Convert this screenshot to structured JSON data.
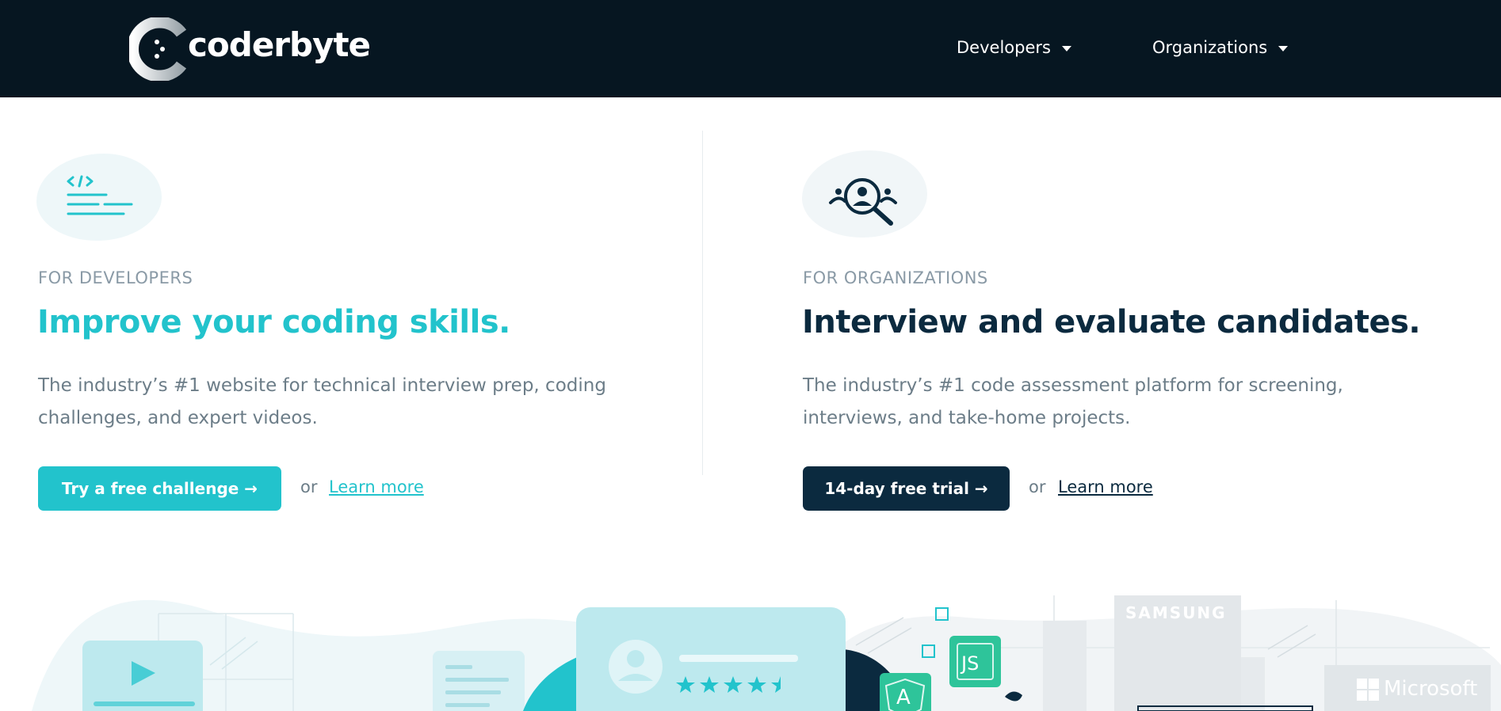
{
  "nav": {
    "logo_text": "coderbyte",
    "items": [
      {
        "label": "Developers"
      },
      {
        "label": "Organizations"
      }
    ]
  },
  "developers": {
    "eyebrow": "FOR DEVELOPERS",
    "headline": "Improve your coding skills.",
    "description_line1": "The industry’s #1 website for technical interview prep, coding",
    "description_line2": "challenges, and expert videos.",
    "cta_label": "Try a free challenge →",
    "or_text": "or",
    "learn_more": "Learn more",
    "icon": "code-document-icon"
  },
  "organizations": {
    "eyebrow": "FOR ORGANIZATIONS",
    "headline": "Interview and evaluate candidates.",
    "description_line1": "The industry’s #1 code assessment platform for screening,",
    "description_line2": "interviews, and take-home projects.",
    "cta_label": "14-day free trial →",
    "or_text": "or",
    "learn_more": "Learn more",
    "icon": "candidate-search-icon"
  },
  "illustration": {
    "badges": [
      "JS",
      "A"
    ],
    "brands": [
      "SAMSUNG",
      "Microsoft"
    ],
    "rating_stars": 4.5
  },
  "colors": {
    "nav_bg": "#061621",
    "teal": "#22c3cc",
    "navy": "#0b2a3f",
    "muted": "#6c7d88"
  }
}
